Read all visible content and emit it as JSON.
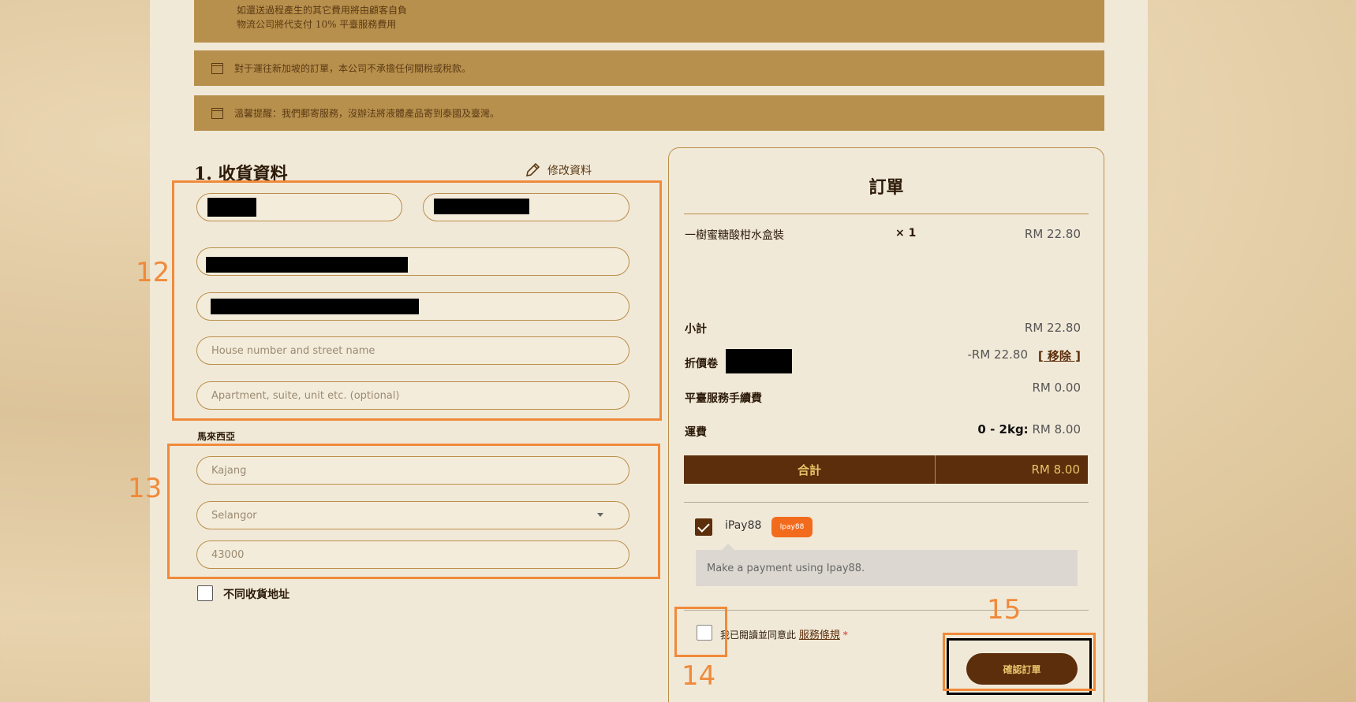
{
  "notices": {
    "shipping_line1": "如還送過程產生的其它費用將由顧客自負",
    "shipping_line2": "物流公司將代支付 10% 平臺服務費用",
    "singapore": "對于運往新加坡的訂單，本公司不承擔任何關稅或稅款。",
    "reminder": "溫馨提醒：我們郵寄服務，沒辦法將液體產品寄到泰國及臺灣。"
  },
  "shipping": {
    "heading": "1. 收貨資料",
    "edit_label": "修改資料",
    "street_placeholder": "House number and street name",
    "apartment_placeholder": "Apartment, suite, unit etc. (optional)",
    "country": "馬來西亞",
    "city": "Kajang",
    "state": "Selangor",
    "postcode": "43000",
    "different_address_label": "不同收貨地址"
  },
  "order": {
    "title": "訂單",
    "item_name": "一樹蜜糖酸柑水盒裝",
    "item_qty": "× 1",
    "item_price": "RM 22.80",
    "subtotal_label": "小計",
    "subtotal_value": "RM 22.80",
    "coupon_label": "折價卷",
    "coupon_value": "-RM 22.80",
    "coupon_remove": "[ 移除 ]",
    "service_fee_label": "平臺服務手續費",
    "service_fee_value": "RM 0.00",
    "shipping_label": "運費",
    "shipping_weight": "0 - 2kg:",
    "shipping_value": "RM 8.00",
    "total_label": "合計",
    "total_value": "RM 8.00",
    "payment_method": "iPay88",
    "payment_badge": "Ipay88",
    "payment_desc": "Make a payment using Ipay88.",
    "terms_text": "我已閱讀並同意此",
    "terms_link": "服務條規",
    "terms_required": "*",
    "confirm_label": "確認訂單"
  },
  "annotations": {
    "box12": "12",
    "box13": "13",
    "box14": "14",
    "box15": "15"
  },
  "colors": {
    "accent_orange": "#f08a3a",
    "brand_brown": "#5c2e0b",
    "notice_bg": "#b8904d"
  }
}
